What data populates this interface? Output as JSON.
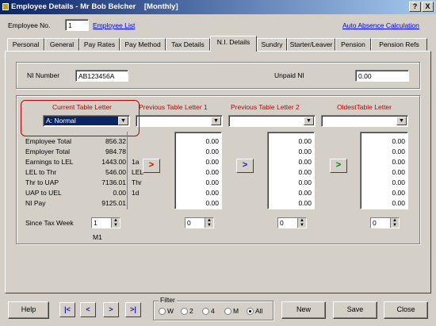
{
  "window": {
    "title": "Employee Details - Mr Bob Belcher",
    "mode": "[Monthly]",
    "help_btn": "?",
    "close_btn": "X"
  },
  "header": {
    "employee_no_label": "Employee No.",
    "employee_no_value": "1",
    "employee_list_link": "Employee List",
    "auto_absence_link": "Auto Absence Calculation"
  },
  "tabs": [
    "Personal",
    "General",
    "Pay Rates",
    "Pay Method",
    "Tax Details",
    "N.I. Details",
    "Sundry",
    "Starter/Leaver",
    "Pension",
    "Pension Refs"
  ],
  "ni": {
    "ni_number_label": "NI Number",
    "ni_number_value": "AB123456A",
    "unpaid_ni_label": "Unpaid NI",
    "unpaid_ni_value": "0.00"
  },
  "tables": {
    "current_label": "Current Table Letter",
    "current_value": "A: Normal",
    "prev1_label": "Previous Table Letter 1",
    "prev2_label": "Previous Table Letter 2",
    "oldest_label": "OldestTable Letter",
    "row_labels": [
      "Employee Total",
      "Employer Total",
      "Earnings to LEL",
      "LEL to Thr",
      "Thr to UAP",
      "UAP to UEL",
      "NI Pay"
    ],
    "current_values": [
      "856.32",
      "984.78",
      "1443.00",
      "546.00",
      "7136.01",
      "0.00",
      "9125.01"
    ],
    "prev1_values": [
      "0.00",
      "0.00",
      "0.00",
      "0.00",
      "0.00",
      "0.00",
      "0.00"
    ],
    "prev2_values": [
      "0.00",
      "0.00",
      "0.00",
      "0.00",
      "0.00",
      "0.00",
      "0.00"
    ],
    "oldest_values": [
      "0.00",
      "0.00",
      "0.00",
      "0.00",
      "0.00",
      "0.00",
      "0.00"
    ],
    "mid_labels": [
      "1a",
      "LEL",
      "Thr",
      "1d"
    ],
    "since_tax_week_label": "Since Tax Week",
    "since_tax_week_current": "1",
    "since_tax_week_prev1": "0",
    "since_tax_week_prev2": "0",
    "since_tax_week_oldest": "0",
    "period_label": "M1",
    "copy_arrow": ">",
    "highlight_color": "#c00000"
  },
  "footer": {
    "help": "Help",
    "nav_first": "|<",
    "nav_prev": "<",
    "nav_next": ">",
    "nav_last": ">|",
    "filter_label": "Filter",
    "filter_options": [
      "W",
      "2",
      "4",
      "M",
      "All"
    ],
    "filter_selected": "All",
    "new": "New",
    "save": "Save",
    "close": "Close"
  }
}
